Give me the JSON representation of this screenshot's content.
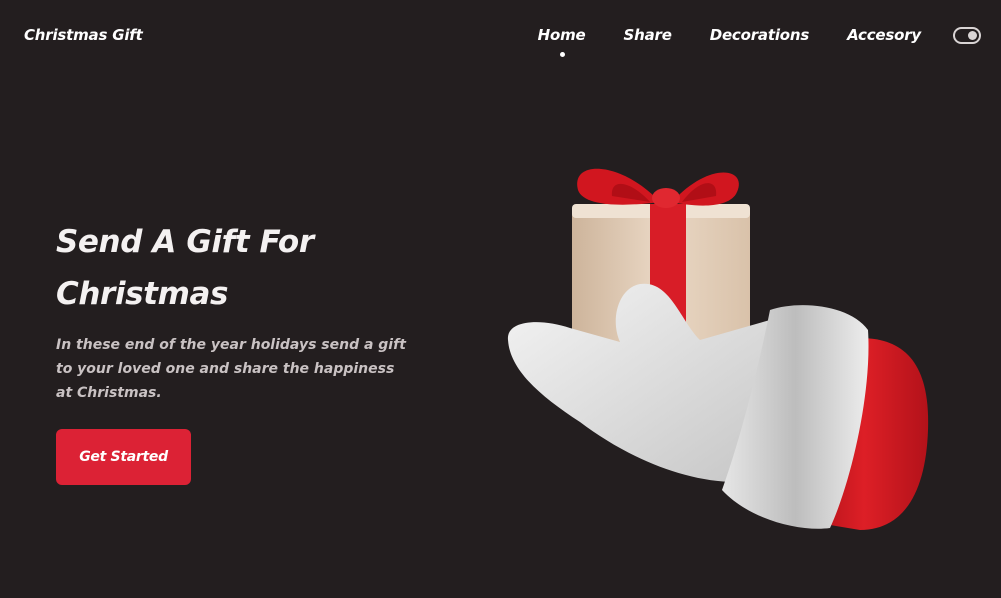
{
  "header": {
    "logo": "Christmas Gift",
    "nav": [
      "Home",
      "Share",
      "Decorations",
      "Accesory"
    ],
    "active_nav": "Home",
    "theme_toggle_icon": "toggle-icon"
  },
  "hero": {
    "title_line1": "Send A Gift For",
    "title_line2": "Christmas",
    "description": "In these end of the year holidays send a gift to your loved one and share the happiness at Christmas.",
    "cta_label": "Get Started",
    "illustration": "santa-glove-holding-gift-icon"
  },
  "colors": {
    "background": "#231e1f",
    "accent": "#dc2235",
    "text": "#ffffff",
    "muted_text": "#c9c2c3"
  }
}
